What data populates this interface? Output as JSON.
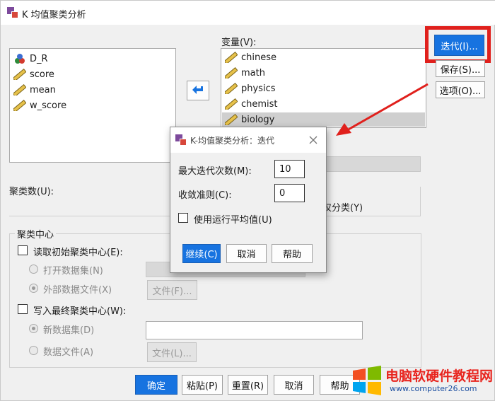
{
  "window": {
    "title": "K 均值聚类分析"
  },
  "source_list": {
    "items": [
      "D_R",
      "score",
      "mean",
      "w_score"
    ]
  },
  "variables": {
    "label": "变量(V):",
    "items": [
      "chinese",
      "math",
      "physics",
      "chemist",
      "biology"
    ]
  },
  "side_buttons": {
    "iterate": "迭代(I)...",
    "save": "保存(S)...",
    "options": "选项(O)..."
  },
  "clusters": {
    "label": "聚类数(U):",
    "partial_label": "仅分类(Y)"
  },
  "center_group": {
    "title": "聚类中心",
    "read_initial": "读取初始聚类中心(E):",
    "open_dataset": "打开数据集(N)",
    "external_file": "外部数据文件(X)",
    "file_button": "文件(F)...",
    "write_final": "写入最终聚类中心(W):",
    "new_dataset": "新数据集(D)",
    "data_file": "数据文件(A)",
    "file_button2": "文件(L)..."
  },
  "bottom_buttons": {
    "ok": "确定",
    "paste": "粘贴(P)",
    "reset": "重置(R)",
    "cancel": "取消",
    "help": "帮助"
  },
  "iterate_dialog": {
    "title": "K-均值聚类分析：迭代",
    "max_iter_label": "最大迭代次数(M):",
    "max_iter_value": "10",
    "converge_label": "收敛准则(C):",
    "converge_value": "0",
    "running_mean": "使用运行平均值(U)",
    "continue": "继续(C)",
    "cancel": "取消",
    "help": "帮助"
  },
  "watermark": {
    "brand": "电脑软硬件教程网",
    "url": "www.computer26.com"
  },
  "colors": {
    "accent_blue": "#1773e0",
    "highlight_red": "#e0201c",
    "logo_red": "#e8251f"
  }
}
